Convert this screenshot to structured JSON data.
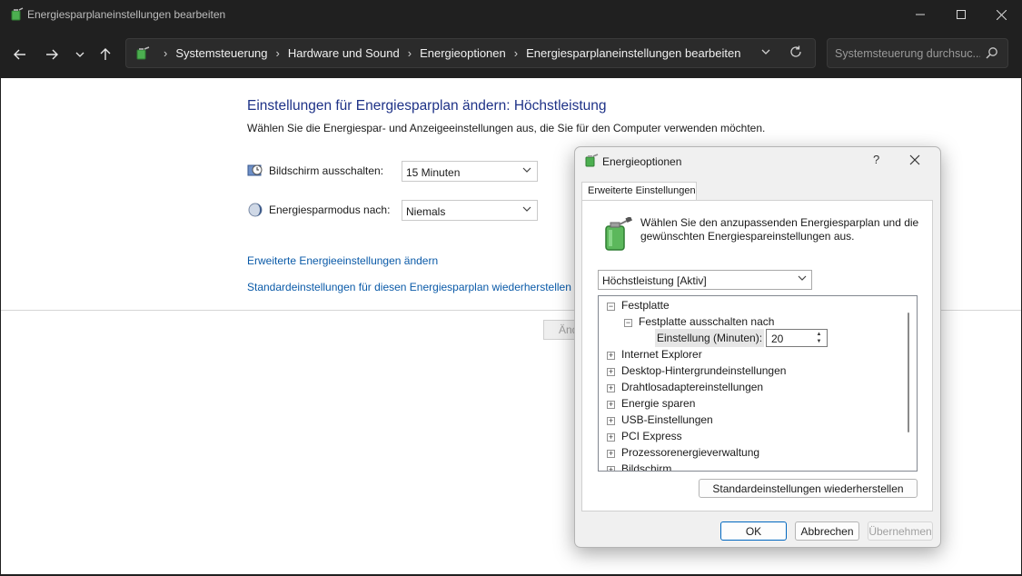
{
  "window": {
    "title": "Energiesparplaneinstellungen bearbeiten"
  },
  "nav": {
    "breadcrumbs": [
      "Systemsteuerung",
      "Hardware und Sound",
      "Energieoptionen",
      "Energiesparplaneinstellungen bearbeiten"
    ],
    "search_placeholder": "Systemsteuerung durchsuc..."
  },
  "main": {
    "heading": "Einstellungen für Energiesparplan ändern: Höchstleistung",
    "subheading": "Wählen Sie die Energiespar- und Anzeigeeinstellungen aus, die Sie für den Computer verwenden möchten.",
    "display_off_label": "Bildschirm ausschalten:",
    "display_off_value": "15 Minuten",
    "sleep_label": "Energiesparmodus nach:",
    "sleep_value": "Niemals",
    "link_advanced": "Erweiterte Energieeinstellungen ändern",
    "link_restore": "Standardeinstellungen für diesen Energiesparplan wiederherstellen",
    "partial_button": "Änd"
  },
  "dialog": {
    "title": "Energieoptionen",
    "help": "?",
    "tab": "Erweiterte Einstellungen",
    "description": "Wählen Sie den anzupassenden Energiesparplan und die gewünschten Energiespareinstellungen aus.",
    "plan_value": "Höchstleistung [Aktiv]",
    "tree": {
      "root": "Festplatte",
      "child": "Festplatte ausschalten nach",
      "setting_label": "Einstellung (Minuten):",
      "setting_value": "20",
      "items": [
        "Internet Explorer",
        "Desktop-Hintergrundeinstellungen",
        "Drahtlosadaptereinstellungen",
        "Energie sparen",
        "USB-Einstellungen",
        "PCI Express",
        "Prozessorenergieverwaltung",
        "Bildschirm"
      ]
    },
    "restore_button": "Standardeinstellungen wiederherstellen",
    "ok_button": "OK",
    "cancel_button": "Abbrechen",
    "apply_button": "Übernehmen"
  }
}
